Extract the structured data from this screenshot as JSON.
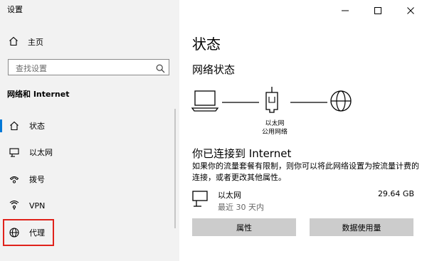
{
  "window": {
    "title": "设置",
    "controls": [
      "minimize",
      "maximize",
      "close"
    ]
  },
  "sidebar": {
    "home_label": "主页",
    "search_placeholder": "查找设置",
    "section_title": "网络和 Internet",
    "items": [
      {
        "label": "状态",
        "icon": "home-icon",
        "active": true
      },
      {
        "label": "以太网",
        "icon": "ethernet-icon"
      },
      {
        "label": "拨号",
        "icon": "dialup-icon"
      },
      {
        "label": "VPN",
        "icon": "vpn-icon"
      },
      {
        "label": "代理",
        "icon": "globe-icon",
        "highlighted": true
      }
    ],
    "highlight_color": "#e0221b",
    "accent_color": "#0078d7"
  },
  "main": {
    "title": "状态",
    "subtitle": "网络状态",
    "device_label_line1": "以太网",
    "device_label_line2": "公用网络",
    "connected_text": "你已连接到 Internet",
    "description_line1": "如果你的流量套餐有限制，则你可以将此网络设置为按流量计费的",
    "description_line2": "连接，或者更改其他属性。",
    "network": {
      "name": "以太网",
      "period": "最近 30 天内",
      "usage": "29.64 GB"
    },
    "buttons": {
      "properties": "属性",
      "data_usage": "数据使用量"
    }
  }
}
